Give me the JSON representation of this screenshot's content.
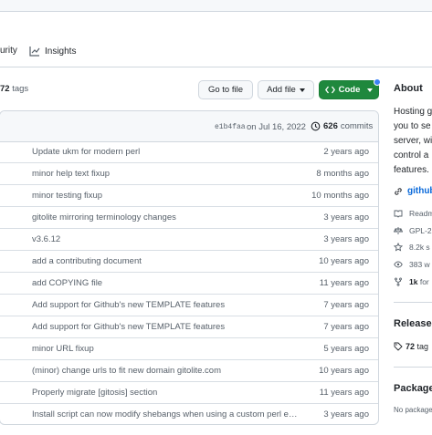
{
  "tabs": {
    "security_partial": "urity",
    "insights": "Insights"
  },
  "tags_line": {
    "count": "72",
    "label": "tags"
  },
  "buttons": {
    "goto_file": "Go to file",
    "add_file": "Add file",
    "code": "Code"
  },
  "latest_commit": {
    "sha": "e1b4faa",
    "date": "on Jul 16, 2022",
    "commits_count": "626",
    "commits_label": "commits"
  },
  "rows": [
    {
      "message": "Update ukm for modern perl",
      "age": "2 years ago"
    },
    {
      "message": "minor help text fixup",
      "age": "8 months ago"
    },
    {
      "message": "minor testing fixup",
      "age": "10 months ago"
    },
    {
      "message": "gitolite mirroring terminology changes",
      "age": "3 years ago"
    },
    {
      "message": "v3.6.12",
      "age": "3 years ago"
    },
    {
      "message": "add a contributing document",
      "age": "10 years ago"
    },
    {
      "message": "add COPYING file",
      "age": "11 years ago"
    },
    {
      "message": "Add support for Github's new TEMPLATE features",
      "age": "7 years ago"
    },
    {
      "message": "Add support for Github's new TEMPLATE features",
      "age": "7 years ago"
    },
    {
      "message": "minor URL fixup",
      "age": "5 years ago"
    },
    {
      "message": "(minor) change urls to fit new domain gitolite.com",
      "age": "10 years ago"
    },
    {
      "message": "Properly migrate [gitosis] section",
      "age": "11 years ago"
    },
    {
      "message": "Install script can now modify shebangs when using a custom perl execu...",
      "age": "3 years ago"
    }
  ],
  "sidebar": {
    "about_title": "About",
    "desc_lines": [
      "Hosting g",
      "you to se",
      "server, wi",
      "control a",
      "features."
    ],
    "link": "github",
    "readme": "Readm",
    "license": "GPL-2",
    "stars": "8.2k s",
    "watchers": "383 w",
    "forks_count": "1k",
    "forks_label": "for",
    "releases_title": "Releases",
    "releases_count": "72",
    "releases_label": "tag",
    "packages_title": "Packages",
    "packages_text": "No package"
  },
  "colors": {
    "accent_green": "#1f883d",
    "link_blue": "#0969da",
    "muted": "#57606a"
  }
}
